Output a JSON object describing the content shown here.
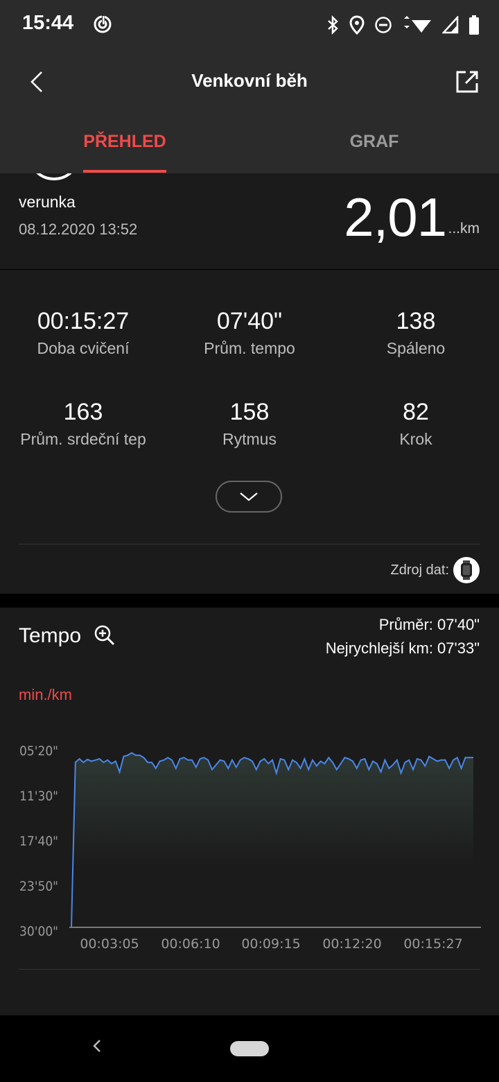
{
  "status_bar": {
    "time": "15:44",
    "icons": [
      "target-icon",
      "bluetooth-icon",
      "location-icon",
      "dnd-icon",
      "wifi-icon",
      "signal-icon",
      "battery-icon"
    ]
  },
  "app_bar": {
    "title": "Venkovní běh",
    "tabs": [
      {
        "label": "PŘEHLED",
        "active": true
      },
      {
        "label": "GRAF",
        "active": false
      }
    ]
  },
  "summary": {
    "username": "verunka",
    "datetime": "08.12.2020 13:52",
    "distance": "2,01",
    "unit": "...km"
  },
  "stats": [
    {
      "value": "00:15:27",
      "label": "Doba cvičení"
    },
    {
      "value": "07'40\"",
      "label": "Prům. tempo"
    },
    {
      "value": "138",
      "label": "Spáleno"
    },
    {
      "value": "163",
      "label": "Prům. srdeční tep"
    },
    {
      "value": "158",
      "label": "Rytmus"
    },
    {
      "value": "82",
      "label": "Krok"
    }
  ],
  "data_source": {
    "label": "Zdroj dat:"
  },
  "tempo_card": {
    "title": "Tempo",
    "average": "Průměr: 07'40\"",
    "fastest": "Nejrychlejší km: 07'33\"",
    "unit": "min./km"
  },
  "chart_data": {
    "type": "area",
    "line_color": "#4a86e8",
    "y_ticks": [
      "05'20\"",
      "11'30\"",
      "17'40\"",
      "23'50\"",
      "30'00\""
    ],
    "x_ticks": [
      "00:03:05",
      "00:06:10",
      "00:09:15",
      "00:12:20",
      "00:15:27"
    ],
    "y_range_seconds": [
      320,
      1800
    ],
    "x_range_seconds": [
      0,
      1000
    ],
    "x": [
      0,
      10,
      20,
      30,
      40,
      50,
      60,
      70,
      80,
      90,
      100,
      110,
      120,
      130,
      140,
      150,
      160,
      170,
      180,
      190,
      200,
      210,
      220,
      230,
      240,
      250,
      260,
      270,
      280,
      290,
      300,
      310,
      320,
      330,
      340,
      350,
      360,
      370,
      380,
      390,
      400,
      410,
      420,
      430,
      440,
      450,
      460,
      470,
      480,
      490,
      500,
      510,
      520,
      530,
      540,
      550,
      560,
      570,
      580,
      590,
      600,
      610,
      620,
      630,
      640,
      650,
      660,
      670,
      680,
      690,
      700,
      710,
      720,
      730,
      740,
      750,
      760,
      770,
      780,
      790,
      800,
      810,
      820,
      830,
      840,
      850,
      860,
      870,
      880,
      890,
      900,
      910,
      920,
      930,
      940,
      950,
      960,
      970,
      980,
      990,
      1000
    ],
    "y": [
      1800,
      420,
      390,
      420,
      395,
      410,
      400,
      390,
      420,
      400,
      430,
      410,
      500,
      370,
      360,
      340,
      360,
      360,
      380,
      420,
      420,
      470,
      410,
      400,
      380,
      400,
      470,
      390,
      380,
      400,
      400,
      460,
      390,
      380,
      400,
      480,
      440,
      400,
      410,
      470,
      400,
      460,
      400,
      380,
      390,
      410,
      480,
      410,
      390,
      430,
      400,
      510,
      390,
      400,
      480,
      400,
      420,
      470,
      390,
      480,
      400,
      450,
      410,
      430,
      380,
      420,
      480,
      430,
      380,
      390,
      410,
      470,
      400,
      390,
      480,
      410,
      430,
      500,
      400,
      470,
      440,
      400,
      510,
      420,
      400,
      480,
      390,
      400,
      450,
      370,
      390,
      410,
      400,
      400,
      470,
      400,
      380,
      470,
      380,
      380,
      380
    ]
  }
}
